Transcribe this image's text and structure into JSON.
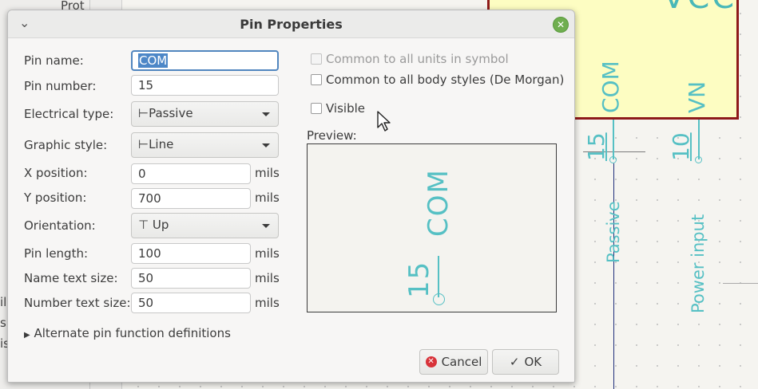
{
  "background": {
    "left_text_top": "Prot",
    "left_text_1": "il",
    "left_text_2": "s",
    "left_text_3": "is",
    "symbol_title": "VCC",
    "pin1_number": "15",
    "pin1_name": "COM",
    "pin1_type": "Passive",
    "pin2_number": "10",
    "pin2_name": "VN",
    "pin2_type": "Power input"
  },
  "dialog": {
    "title": "Pin Properties",
    "fields": {
      "pin_name": {
        "label": "Pin name:",
        "value": "COM"
      },
      "pin_number": {
        "label": "Pin number:",
        "value": "15"
      },
      "electrical_type": {
        "label": "Electrical type:",
        "value": "Passive",
        "glyph": "⊢"
      },
      "graphic_style": {
        "label": "Graphic style:",
        "value": "Line",
        "glyph": "⊢"
      },
      "x_position": {
        "label": "X position:",
        "value": "0",
        "unit": "mils"
      },
      "y_position": {
        "label": "Y position:",
        "value": "700",
        "unit": "mils"
      },
      "orientation": {
        "label": "Orientation:",
        "value": "Up",
        "glyph": "⊤"
      },
      "pin_length": {
        "label": "Pin length:",
        "value": "100",
        "unit": "mils"
      },
      "name_text_size": {
        "label": "Name text size:",
        "value": "50",
        "unit": "mils"
      },
      "number_text_size": {
        "label": "Number text size:",
        "value": "50",
        "unit": "mils"
      }
    },
    "checkboxes": {
      "common_units": {
        "label": "Common to all units in symbol",
        "checked": false,
        "enabled": false
      },
      "common_styles": {
        "label": "Common to all body styles (De Morgan)",
        "checked": false,
        "enabled": true
      },
      "visible": {
        "label": "Visible",
        "checked": false,
        "enabled": true
      }
    },
    "preview_label": "Preview:",
    "preview": {
      "pin_number": "15",
      "pin_name": "COM"
    },
    "alternates_label": "Alternate pin function definitions",
    "buttons": {
      "cancel": "Cancel",
      "ok": "OK"
    }
  },
  "colors": {
    "pin": "#56c0c4",
    "symbol_border": "#8e1a1a",
    "symbol_fill": "#fdfdc2",
    "accent": "#4d87c7"
  }
}
